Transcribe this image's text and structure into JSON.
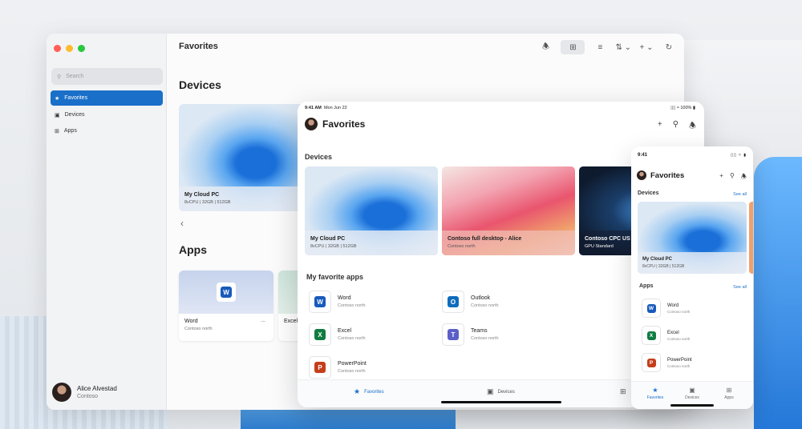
{
  "desktop": {
    "title": "Favorites",
    "search_placeholder": "Search",
    "nav": [
      {
        "label": "Favorites",
        "icon": "star-icon"
      },
      {
        "label": "Devices",
        "icon": "monitor-icon"
      },
      {
        "label": "Apps",
        "icon": "grid-icon"
      }
    ],
    "user": {
      "name": "Alice Alvestad",
      "org": "Contoso"
    },
    "devices_heading": "Devices",
    "device": {
      "name": "My Cloud PC",
      "spec": "8vCPU | 32GB | 512GB"
    },
    "apps_heading": "Apps",
    "apps": [
      {
        "name": "Word",
        "org": "Contoso north"
      },
      {
        "name": "Excel",
        "org": ""
      }
    ],
    "more_label": "..."
  },
  "tablet": {
    "time": "9:41 AM",
    "date": "Mon Jun 22",
    "battery": "100%",
    "title": "Favorites",
    "devices_heading": "Devices",
    "devices": [
      {
        "name": "My Cloud PC",
        "spec": "8vCPU | 32GB | 512GB"
      },
      {
        "name": "Contoso full desktop - Alice",
        "spec": "Contoso north"
      },
      {
        "name": "Contoso CPC US",
        "spec": "GPU Standard"
      }
    ],
    "apps_heading": "My favorite apps",
    "apps": [
      {
        "name": "Word",
        "org": "Contoso north",
        "letter": "W",
        "color": "#185abd"
      },
      {
        "name": "Outlook",
        "org": "Contoso north",
        "letter": "O",
        "color": "#0f6cbd"
      },
      {
        "name": "Excel",
        "org": "Contoso north",
        "letter": "X",
        "color": "#107c41"
      },
      {
        "name": "Teams",
        "org": "Contoso north",
        "letter": "T",
        "color": "#5b5fc7"
      },
      {
        "name": "PowerPoint",
        "org": "Contoso north",
        "letter": "P",
        "color": "#c43e1c"
      }
    ],
    "tabs": [
      "Favorites",
      "Devices"
    ]
  },
  "phone": {
    "time": "9:41",
    "title": "Favorites",
    "devices_heading": "Devices",
    "see_all": "See all",
    "device": {
      "name": "My Cloud PC",
      "spec": "8vCPU | 32GB | 512GB"
    },
    "apps_heading": "Apps",
    "apps": [
      {
        "name": "Word",
        "org": "Contoso north",
        "letter": "W",
        "color": "#185abd"
      },
      {
        "name": "Excel",
        "org": "Contoso north",
        "letter": "X",
        "color": "#107c41"
      },
      {
        "name": "PowerPoint",
        "org": "Contoso north",
        "letter": "P",
        "color": "#c43e1c"
      }
    ],
    "tabs": [
      "Favorites",
      "Devices",
      "Apps"
    ]
  },
  "colors": {
    "accent": "#1a6fc8"
  }
}
